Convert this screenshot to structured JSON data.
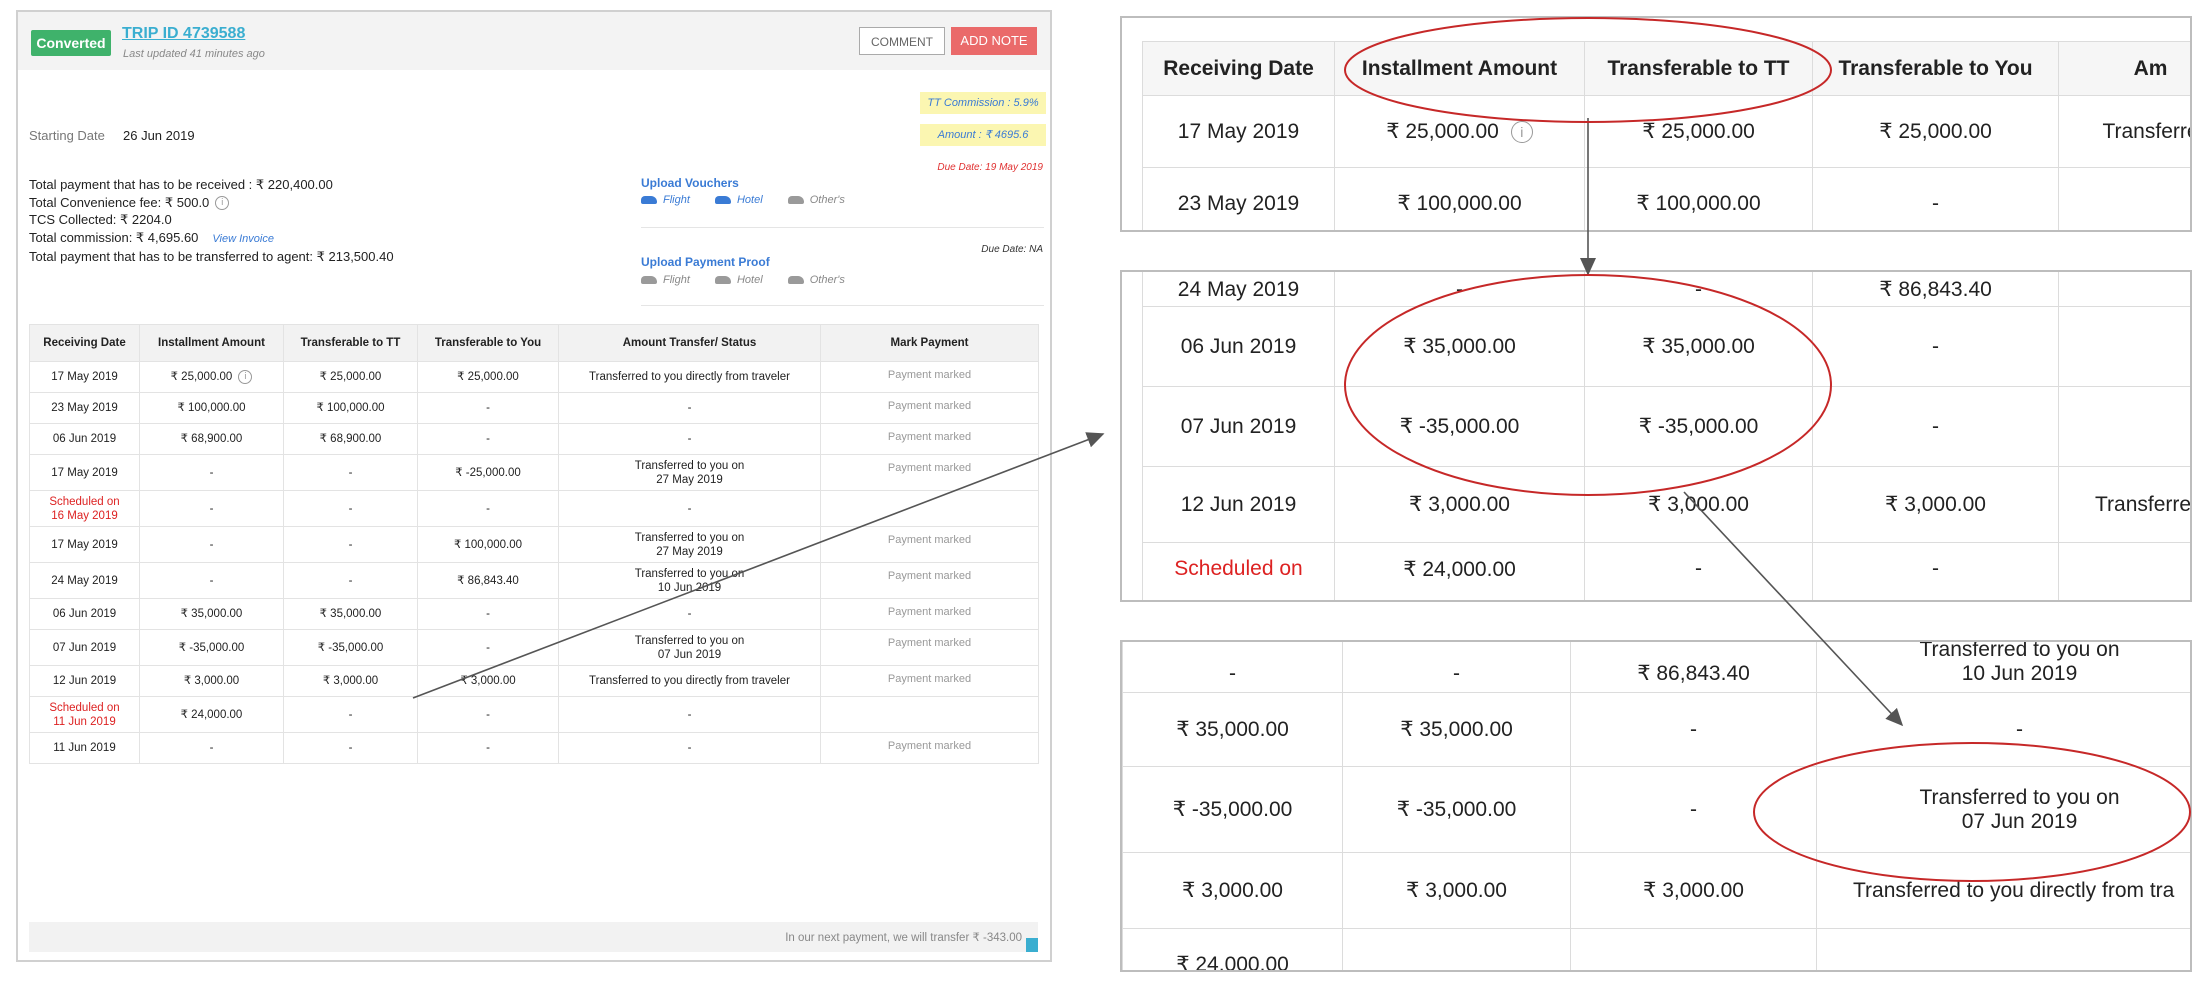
{
  "header": {
    "badge": "Converted",
    "trip_id": "TRIP ID 4739588",
    "updated": "Last updated 41 minutes ago",
    "comment_btn": "COMMENT",
    "add_note_btn": "ADD NOTE"
  },
  "info": {
    "tt_commission": "TT Commission : 5.9%",
    "amount": "Amount : ₹ 4695.6",
    "due_date_1": "Due Date: 19 May 2019",
    "due_date_2": "Due Date: NA",
    "starting_label": "Starting Date",
    "starting_value": "26 Jun 2019",
    "lines": [
      "Total payment that has to be received : ₹ 220,400.00",
      "Total Convenience fee: ₹ 500.0",
      "TCS Collected: ₹ 2204.0",
      "Total commission: ₹ 4,695.60",
      "Total payment that has to be transferred to agent: ₹ 213,500.40"
    ],
    "view_invoice": "View Invoice",
    "info_icon": "i"
  },
  "uploads": {
    "vouchers_title": "Upload Vouchers",
    "vouchers_items": [
      "Flight",
      "Hotel",
      "Other's"
    ],
    "proof_title": "Upload Payment Proof",
    "proof_items": [
      "Flight",
      "Hotel",
      "Other's"
    ],
    "icon_colors": {
      "active": "#3a7bd5",
      "inactive": "#9a9a9a",
      "inactive_text": "#888888"
    }
  },
  "table": {
    "headers": [
      "Receiving Date",
      "Installment Amount",
      "Transferable to TT",
      "Transferable to You",
      "Amount Transfer/ Status",
      "Mark Payment"
    ],
    "rows": [
      {
        "date": "17 May 2019",
        "inst": "₹ 25,000.00",
        "tt": "₹ 25,000.00",
        "you": "₹ 25,000.00",
        "status": "Transferred to you directly from traveler",
        "mark": "Payment marked",
        "info": true
      },
      {
        "date": "23 May 2019",
        "inst": "₹ 100,000.00",
        "tt": "₹ 100,000.00",
        "you": "-",
        "status": "-",
        "mark": "Payment marked"
      },
      {
        "date": "06 Jun 2019",
        "inst": "₹ 68,900.00",
        "tt": "₹ 68,900.00",
        "you": "-",
        "status": "-",
        "mark": "Payment marked"
      },
      {
        "date": "17 May 2019",
        "inst": "-",
        "tt": "-",
        "you": "₹ -25,000.00",
        "status": "Transferred to you on\n27 May 2019",
        "mark": "Payment marked"
      },
      {
        "date": "Scheduled on\n16 May 2019",
        "inst": "-",
        "tt": "-",
        "you": "-",
        "status": "-",
        "mark": "",
        "red": true
      },
      {
        "date": "17 May 2019",
        "inst": "-",
        "tt": "-",
        "you": "₹ 100,000.00",
        "status": "Transferred to you on\n27 May 2019",
        "mark": "Payment marked"
      },
      {
        "date": "24 May 2019",
        "inst": "-",
        "tt": "-",
        "you": "₹ 86,843.40",
        "status": "Transferred to you on\n10 Jun 2019",
        "mark": "Payment marked"
      },
      {
        "date": "06 Jun 2019",
        "inst": "₹ 35,000.00",
        "tt": "₹ 35,000.00",
        "you": "-",
        "status": "-",
        "mark": "Payment marked"
      },
      {
        "date": "07 Jun 2019",
        "inst": "₹ -35,000.00",
        "tt": "₹ -35,000.00",
        "you": "-",
        "status": "Transferred to you on\n07 Jun 2019",
        "mark": "Payment marked"
      },
      {
        "date": "12 Jun 2019",
        "inst": "₹ 3,000.00",
        "tt": "₹ 3,000.00",
        "you": "₹ 3,000.00",
        "status": "Transferred to you directly from traveler",
        "mark": "Payment marked"
      },
      {
        "date": "Scheduled on\n11 Jun 2019",
        "inst": "₹ 24,000.00",
        "tt": "-",
        "you": "-",
        "status": "-",
        "mark": "",
        "red": true
      },
      {
        "date": "11 Jun 2019",
        "inst": "-",
        "tt": "-",
        "you": "-",
        "status": "-",
        "mark": "Payment marked"
      }
    ],
    "footer": "In our next payment, we will transfer ₹ -343.00"
  },
  "zoom1": {
    "headers": [
      "Receiving Date",
      "Installment Amount",
      "Transferable to TT",
      "Transferable to You",
      "Am"
    ],
    "rows": [
      [
        "17 May 2019",
        "₹ 25,000.00",
        "₹ 25,000.00",
        "₹ 25,000.00",
        "Transferre"
      ],
      [
        "23 May 2019",
        "₹ 100,000.00",
        "₹ 100,000.00",
        "-",
        ""
      ]
    ]
  },
  "zoom2": {
    "rows": [
      [
        "24 May 2019",
        "-",
        "-",
        "₹ 86,843.40",
        ""
      ],
      [
        "06 Jun 2019",
        "₹ 35,000.00",
        "₹ 35,000.00",
        "-",
        ""
      ],
      [
        "07 Jun 2019",
        "₹ -35,000.00",
        "₹ -35,000.00",
        "-",
        "T"
      ],
      [
        "12 Jun 2019",
        "₹ 3,000.00",
        "₹ 3,000.00",
        "₹ 3,000.00",
        "Transferre"
      ],
      [
        "Scheduled on",
        "₹ 24,000.00",
        "-",
        "-",
        ""
      ]
    ]
  },
  "zoom3": {
    "rows": [
      [
        "-",
        "-",
        "₹ 86,843.40",
        "Transferred to you on\n10 Jun 2019"
      ],
      [
        "₹ 35,000.00",
        "₹ 35,000.00",
        "-",
        "-"
      ],
      [
        "₹ -35,000.00",
        "₹ -35,000.00",
        "-",
        "Transferred to you on\n07 Jun 2019"
      ],
      [
        "₹ 3,000.00",
        "₹ 3,000.00",
        "₹ 3,000.00",
        "Transferred to you directly from tra"
      ],
      [
        "₹ 24,000.00",
        "",
        "",
        ""
      ]
    ]
  },
  "annotation_color": "#c62828"
}
